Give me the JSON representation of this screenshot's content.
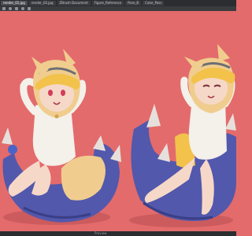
{
  "tabs": [
    {
      "label": "render_01.jpg"
    },
    {
      "label": "render_02.jpg"
    },
    {
      "label": "ZBrush Document"
    },
    {
      "label": "Figure_Reference"
    },
    {
      "label": "Pose_B"
    },
    {
      "label": "Color_Pass"
    }
  ],
  "status": {
    "text": "Preview"
  },
  "colors": {
    "background": "#e36b6c",
    "beanbag": "#5258ac",
    "claws": "#e6e0dc",
    "hat": "#f2c24a",
    "hair": "#f0cd8e",
    "shirt": "#f4f0ea",
    "skin": "#f6d8c8"
  }
}
